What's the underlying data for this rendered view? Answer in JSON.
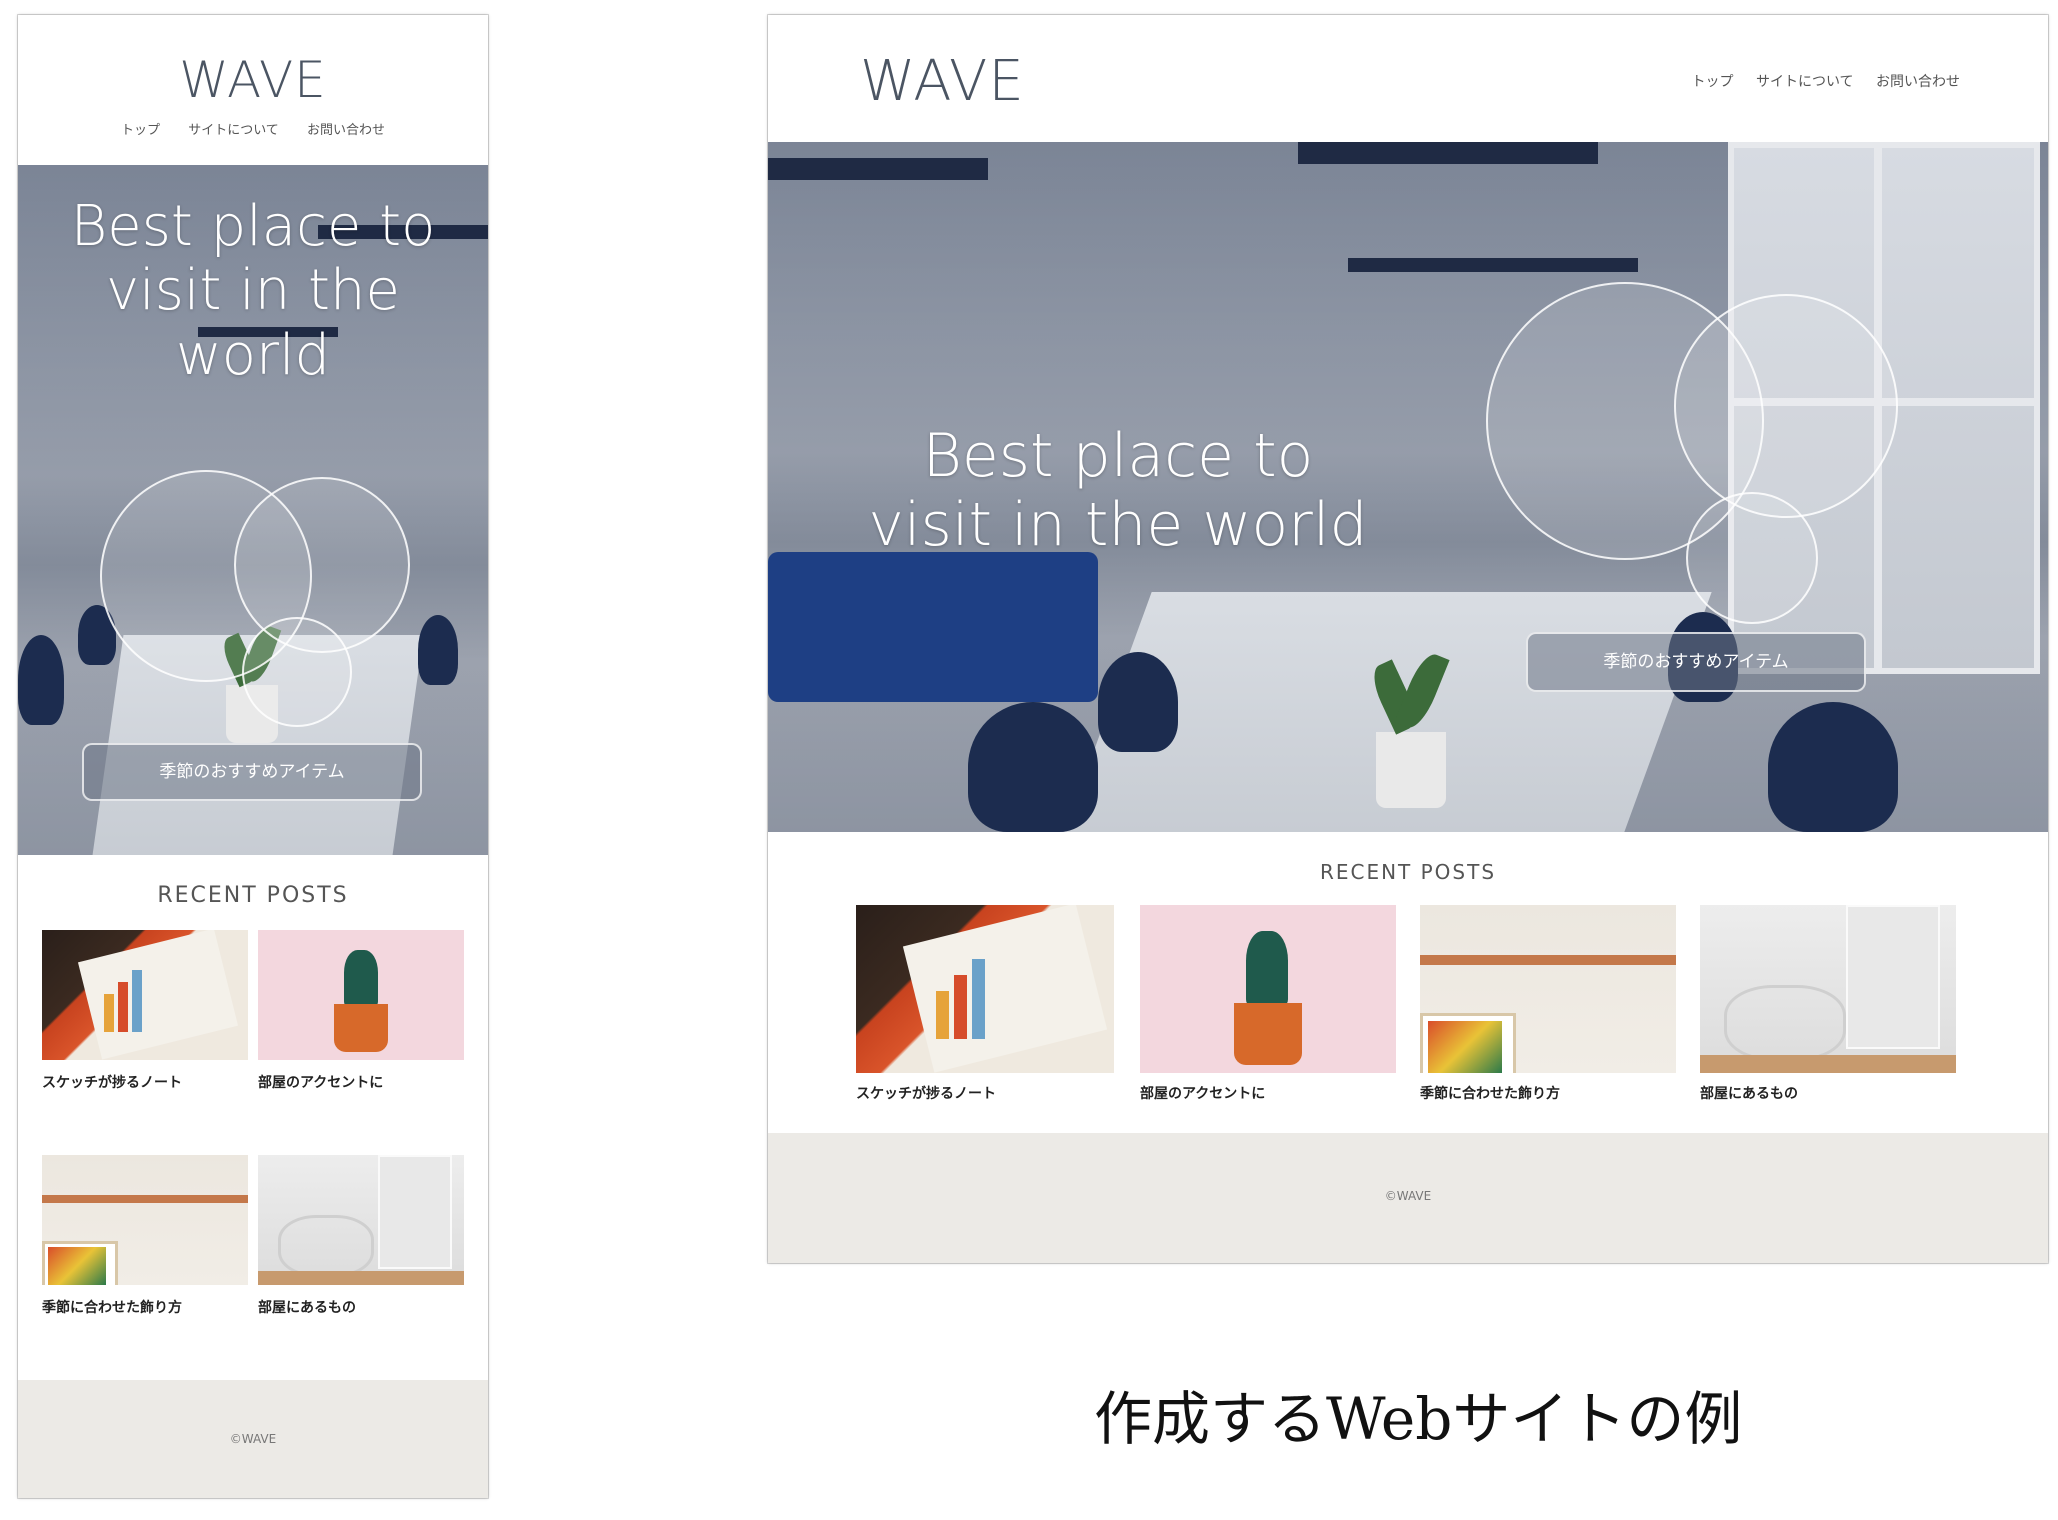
{
  "site": {
    "logo": "WAVE",
    "nav": [
      "トップ",
      "サイトについて",
      "お問い合わせ"
    ],
    "hero_title_desktop": "Best place to visit in the world",
    "hero_title_mobile": [
      "Best place to",
      "visit in the",
      "world"
    ],
    "hero_button": "季節のおすすめアイテム",
    "recent_posts_label": "RECENT POSTS",
    "posts": [
      {
        "title": "スケッチが捗るノート",
        "thumb": "notebook"
      },
      {
        "title": "部屋のアクセントに",
        "thumb": "cactus"
      },
      {
        "title": "季節に合わせた飾り方",
        "thumb": "shelf"
      },
      {
        "title": "部屋にあるもの",
        "thumb": "chair"
      }
    ],
    "copyright": "©WAVE"
  },
  "caption": "作成するWebサイトの例"
}
